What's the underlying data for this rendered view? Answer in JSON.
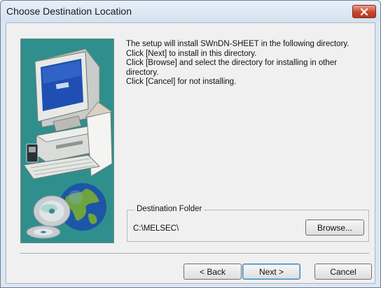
{
  "window": {
    "title": "Choose Destination Location",
    "close_label": "x"
  },
  "instructions": {
    "lines": [
      "The setup will install SWnDN-SHEET in the following directory.",
      "Click [Next] to install in this directory.",
      "Click [Browse] and select the directory for installing in other directory.",
      "Click [Cancel] for not installing."
    ]
  },
  "destination": {
    "legend": "Destination Folder",
    "path": "C:\\MELSEC\\",
    "browse_label": "Browse..."
  },
  "buttons": {
    "back_label": "< Back",
    "next_label": "Next >",
    "cancel_label": "Cancel"
  },
  "colors": {
    "side_panel": "#2e8f8c",
    "close_button": "#c8452b"
  },
  "icons": {
    "side_panel_art": "computer-with-globe-and-cds-illustration"
  }
}
